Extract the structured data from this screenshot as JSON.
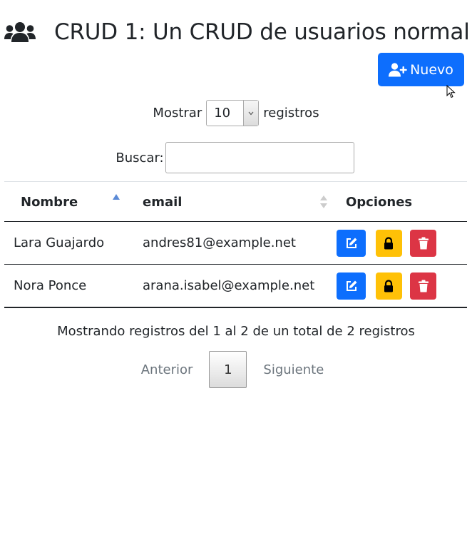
{
  "header": {
    "title": "CRUD 1: Un CRUD de usuarios normal",
    "icon": "users-icon"
  },
  "new_button": {
    "label": "Nuevo",
    "icon": "user-plus-icon",
    "color": "#0d6efd"
  },
  "length_control": {
    "prefix": "Mostrar",
    "value": "10",
    "suffix": "registros"
  },
  "search": {
    "label": "Buscar:",
    "value": ""
  },
  "table": {
    "columns": [
      {
        "label": "Nombre",
        "sort": "ascending"
      },
      {
        "label": "email",
        "sort": "sortable"
      },
      {
        "label": "Opciones",
        "sort": "none"
      }
    ],
    "rows": [
      {
        "nombre": "Lara Guajardo",
        "email": "andres81@example.net"
      },
      {
        "nombre": "Nora Ponce",
        "email": "arana.isabel@example.net"
      }
    ],
    "action_colors": {
      "edit": "#0d6efd",
      "lock": "#ffc107",
      "delete": "#dc3545"
    }
  },
  "info": "Mostrando registros del 1 al 2 de un total de 2 registros",
  "pagination": {
    "previous": "Anterior",
    "current": "1",
    "next": "Siguiente"
  }
}
